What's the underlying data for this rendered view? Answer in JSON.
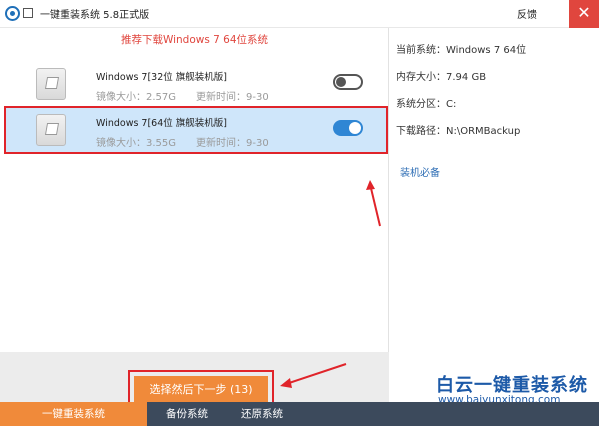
{
  "window": {
    "title": "一键重装系统 5.8正式版",
    "feedback_label": "反馈",
    "close_label": "✕"
  },
  "recommend_text": "推荐下载Windows 7 64位系统",
  "os_list": [
    {
      "name": "Windows 7[32位 旗舰装机版]",
      "size": "镜像大小：2.57G",
      "update": "更新时间：9-30",
      "enabled": false
    },
    {
      "name": "Windows 7[64位 旗舰装机版]",
      "size": "镜像大小：3.55G",
      "update": "更新时间：9-30",
      "enabled": true
    }
  ],
  "next_button_label": "选择然后下一步 (13)",
  "info": {
    "current_system": "当前系统：Windows 7 64位",
    "memory": "内存大小：7.94 GB",
    "partition": "系统分区：C:",
    "download_path": "下载路径：N:\\ORMBackup",
    "essentials_link": "装机必备"
  },
  "watermark": {
    "title": "白云一键重装系统",
    "url": "www.baiyunxitong.com"
  },
  "tabs": [
    "一键重装系统",
    "备份系统",
    "还原系统"
  ],
  "colors": {
    "accent_orange": "#f08a3a",
    "toggle_on": "#2f86d4",
    "annotation_red": "#e0242a",
    "recommend_red": "#e0463e",
    "tab_bar": "#3c4a5c"
  }
}
